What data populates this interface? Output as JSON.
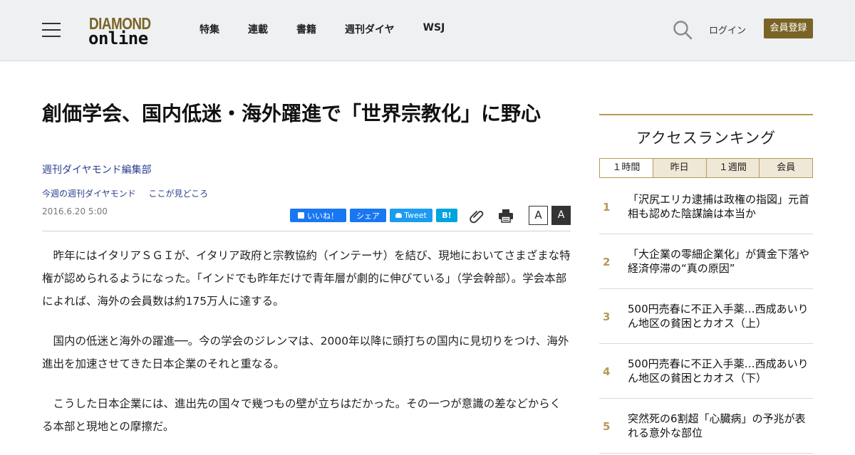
{
  "header": {
    "logo_line1": "DIAMOND",
    "logo_line2": "online",
    "nav": [
      "特集",
      "連載",
      "書籍",
      "週刊ダイヤ",
      "WSJ"
    ],
    "login": "ログイン",
    "register": "会員登録"
  },
  "article": {
    "title": "創価学会、国内低迷・海外躍進で「世界宗教化」に野心",
    "author": "週刊ダイヤモンド編集部",
    "category1": "今週の週刊ダイヤモンド",
    "category2": "ここが見どころ",
    "date": "2016.6.20 5:00",
    "paragraphs": [
      "昨年にはイタリアＳＧＩが、イタリア政府と宗教協約（インテーサ）を結び、現地においてさまざまな特権が認められるようになった。「インドでも昨年だけで青年層が劇的に伸びている」（学会幹部）。学会本部によれば、海外の会員数は約175万人に達する。",
      "国内の低迷と海外の躍進──。今の学会のジレンマは、2000年以降に頭打ちの国内に見切りをつけ、海外進出を加速させてきた日本企業のそれと重なる。",
      "こうした日本企業には、進出先の国々で幾つもの壁が立ちはだかった。その一つが意識の差などからくる本部と現地との摩擦だ。"
    ]
  },
  "share": {
    "like": "いいね！",
    "share": "シェア",
    "tweet": "Tweet",
    "hatena": "B!",
    "font_small": "A",
    "font_large": "A"
  },
  "ranking": {
    "title": "アクセスランキング",
    "tabs": [
      "１時間",
      "昨日",
      "１週間",
      "会員"
    ],
    "items": [
      {
        "num": "1",
        "text": "「沢尻エリカ逮捕は政権の指図」元首相も認めた陰謀論は本当か"
      },
      {
        "num": "2",
        "text": "「大企業の零細企業化」が賃金下落や経済停滞の“真の原因”"
      },
      {
        "num": "3",
        "text": "500円売春に不正入手薬…西成あいりん地区の貧困とカオス（上）"
      },
      {
        "num": "4",
        "text": "500円売春に不正入手薬…西成あいりん地区の貧困とカオス（下）"
      },
      {
        "num": "5",
        "text": "突然死の6割超「心臓病」の予兆が表れる意外な部位"
      }
    ]
  }
}
